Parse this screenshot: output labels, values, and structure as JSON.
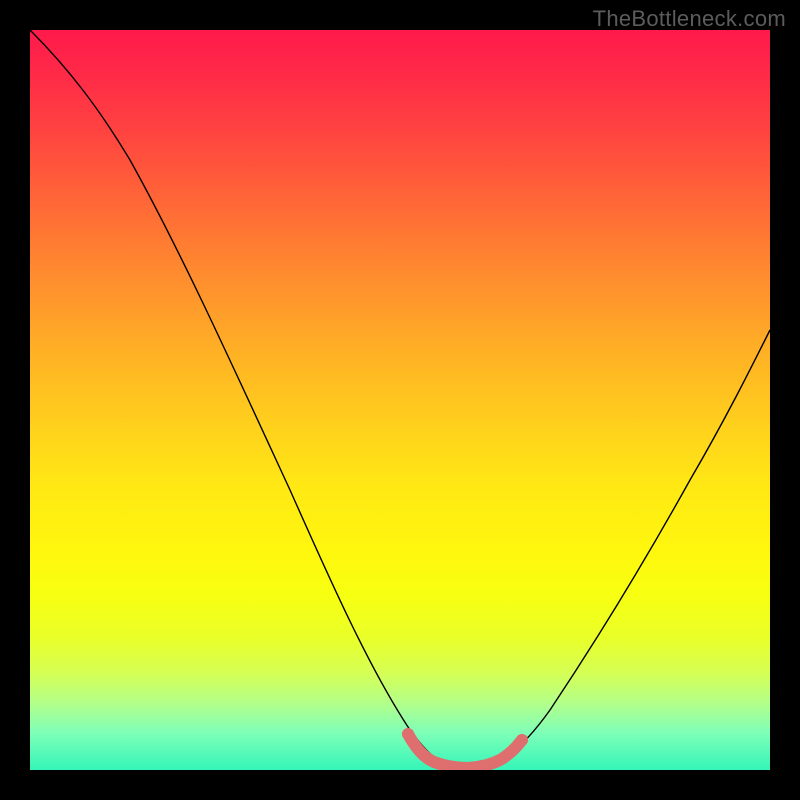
{
  "watermark": "TheBottleneck.com",
  "chart_data": {
    "type": "line",
    "title": "",
    "xlabel": "",
    "ylabel": "",
    "x_range": [
      0,
      100
    ],
    "y_range": [
      0,
      100
    ],
    "grid": false,
    "legend": false,
    "annotations": [],
    "background_gradient_stops": [
      {
        "pos": 0.0,
        "color": "#ff1a4b"
      },
      {
        "pos": 0.5,
        "color": "#ffd21c"
      },
      {
        "pos": 0.8,
        "color": "#f0ff1a"
      },
      {
        "pos": 1.0,
        "color": "#34f5b8"
      }
    ],
    "series": [
      {
        "name": "bottleneck-curve",
        "color": "#000000",
        "stroke_width": 1,
        "x": [
          0,
          4,
          8,
          12,
          16,
          20,
          24,
          28,
          32,
          36,
          40,
          44,
          48,
          50,
          52,
          54,
          56,
          58,
          60,
          62,
          66,
          70,
          74,
          78,
          82,
          86,
          90,
          94,
          98,
          100
        ],
        "y": [
          100,
          96,
          92,
          87,
          82,
          76,
          70,
          63,
          55,
          47,
          38,
          28,
          17,
          11,
          6,
          3,
          1,
          0,
          0,
          1,
          4,
          9,
          15,
          22,
          30,
          38,
          46,
          54,
          62,
          66
        ]
      },
      {
        "name": "optimal-zone-highlight",
        "color": "#e06a6a",
        "stroke_width": 10,
        "x": [
          52,
          54,
          56,
          58,
          60,
          62,
          64
        ],
        "y": [
          4,
          1.5,
          0.5,
          0,
          0.3,
          1.2,
          3
        ]
      }
    ]
  }
}
